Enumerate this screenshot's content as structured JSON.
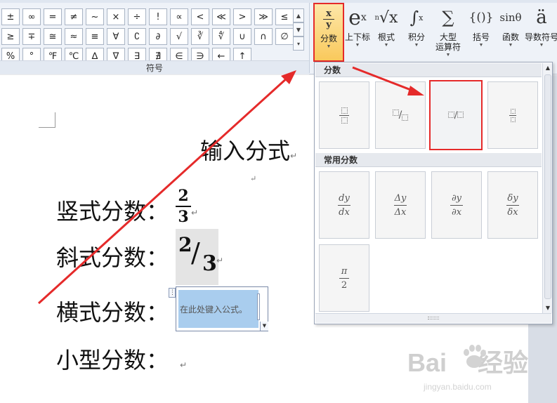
{
  "ribbon": {
    "symbols": [
      "±",
      "∞",
      "=",
      "≠",
      "~",
      "×",
      "÷",
      "!",
      "∝",
      "<",
      "≪",
      ">",
      "≫",
      "≤",
      "≥",
      "∓",
      "≅",
      "≈",
      "≡",
      "∀",
      "∁",
      "∂",
      "√",
      "∛",
      "∜",
      "∪",
      "∩",
      "∅",
      "%",
      "°",
      "℉",
      "℃",
      "∆",
      "∇",
      "∃",
      "∄",
      "∈",
      "∋",
      "←",
      "↑"
    ],
    "symbols_group_label": "符号",
    "tools": [
      {
        "id": "fraction",
        "label": "分数",
        "icon": "fraction-icon"
      },
      {
        "id": "script",
        "label": "上下标",
        "icon": "script-icon"
      },
      {
        "id": "radical",
        "label": "根式",
        "icon": "radical-icon"
      },
      {
        "id": "integral",
        "label": "积分",
        "icon": "integral-icon"
      },
      {
        "id": "large_operator",
        "label": "大型\n运算符",
        "icon": "sum-icon"
      },
      {
        "id": "bracket",
        "label": "括号",
        "icon": "bracket-icon"
      },
      {
        "id": "function",
        "label": "函数",
        "icon": "function-icon"
      },
      {
        "id": "accent",
        "label": "导数符号",
        "icon": "accent-icon"
      }
    ]
  },
  "gallery": {
    "section_fraction": "分数",
    "section_common": "常用分数",
    "common": [
      {
        "num": "dy",
        "den": "dx"
      },
      {
        "num": "Δy",
        "den": "Δx"
      },
      {
        "num": "∂y",
        "den": "∂x"
      },
      {
        "num": "δy",
        "den": "δx"
      },
      {
        "num": "π",
        "den": "2"
      }
    ]
  },
  "document": {
    "heading": "输入分式",
    "lines": [
      "竖式分数：",
      "斜式分数：",
      "横式分数：",
      "小型分数："
    ],
    "vert_num": "2",
    "vert_den": "3",
    "slant_num": "2",
    "slant_den": "3",
    "equation_placeholder": "在此处键入公式。",
    "para_mark": "↵"
  },
  "watermark": {
    "brand": "Bai",
    "brand2": "经验",
    "url": "jingyan.baidu.com"
  },
  "colors": {
    "highlight": "#e52a2a",
    "equation_field": "#a9cdee"
  }
}
